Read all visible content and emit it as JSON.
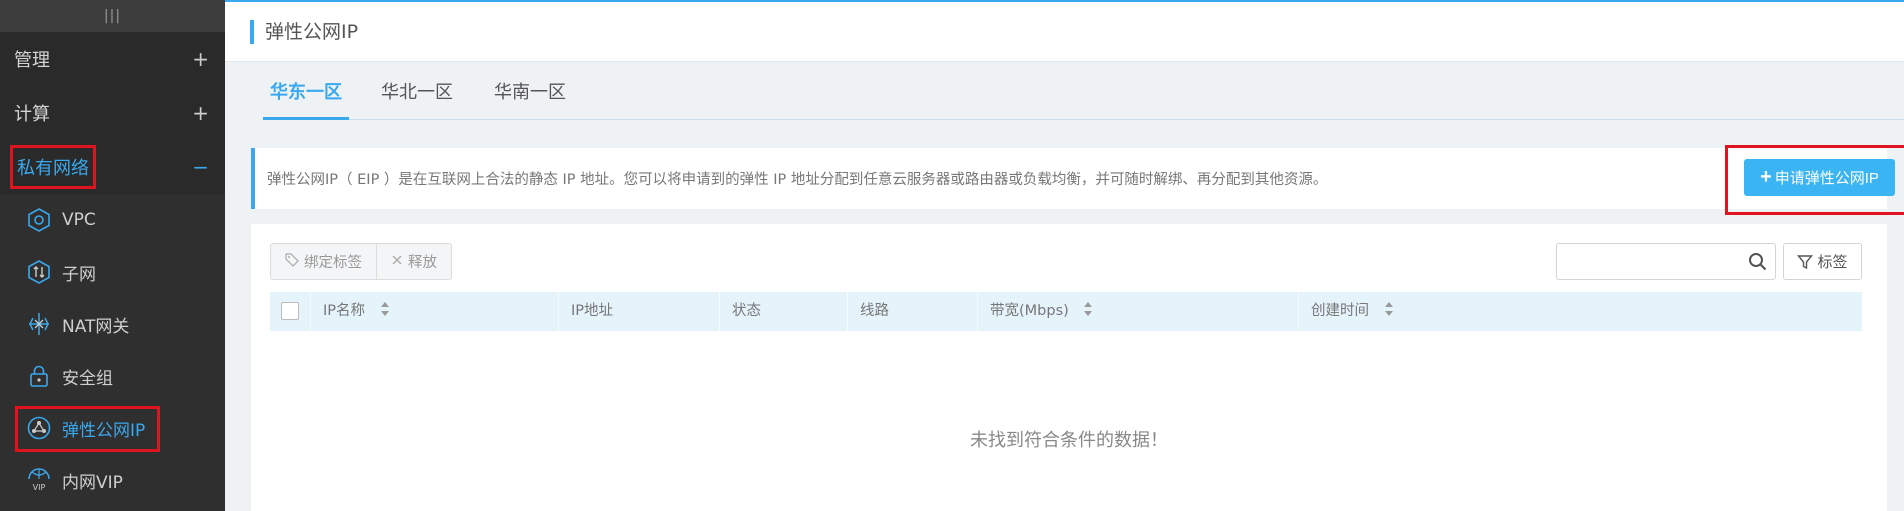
{
  "sidebar": {
    "handle": "|||",
    "groups": [
      {
        "label": "管理",
        "sign": "+"
      },
      {
        "label": "计算",
        "sign": "+"
      },
      {
        "label": "私有网络",
        "sign": "−"
      }
    ],
    "items": [
      {
        "label": "VPC",
        "icon": "vpc-icon"
      },
      {
        "label": "子网",
        "icon": "subnet-icon"
      },
      {
        "label": "NAT网关",
        "icon": "nat-gateway-icon"
      },
      {
        "label": "安全组",
        "icon": "lock-icon"
      },
      {
        "label": "弹性公网IP",
        "icon": "eip-icon"
      },
      {
        "label": "内网VIP",
        "icon": "vip-icon"
      }
    ]
  },
  "header": {
    "title": "弹性公网IP"
  },
  "tabs": [
    {
      "label": "华东一区",
      "active": true
    },
    {
      "label": "华北一区",
      "active": false
    },
    {
      "label": "华南一区",
      "active": false
    }
  ],
  "info": {
    "text": "弹性公网IP（ EIP ）是在互联网上合法的静态 IP 地址。您可以将申请到的弹性 IP 地址分配到任意云服务器或路由器或负载均衡，并可随时解绑、再分配到其他资源。",
    "apply_button": "申请弹性公网IP"
  },
  "toolbar": {
    "bind_tag": "绑定标签",
    "release": "释放",
    "search_placeholder": "",
    "tag_button": "标签"
  },
  "table": {
    "columns": [
      "IP名称",
      "IP地址",
      "状态",
      "线路",
      "带宽(Mbps)",
      "创建时间"
    ],
    "empty_text": "未找到符合条件的数据！"
  },
  "colors": {
    "accent": "#3aa8ee",
    "highlight": "#e0141e",
    "sidebar": "#2f2f2f"
  }
}
